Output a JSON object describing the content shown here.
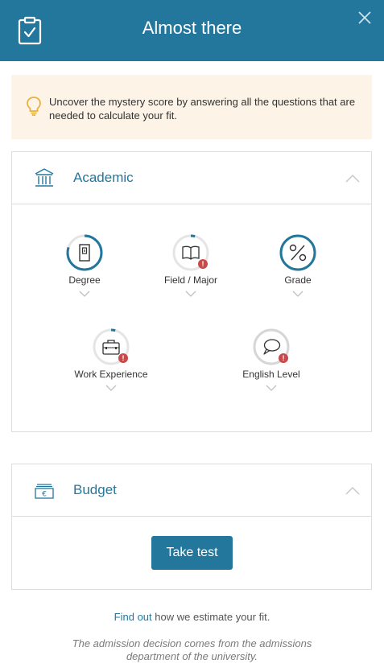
{
  "header": {
    "title": "Almost there"
  },
  "tip": {
    "text": "Uncover the mystery score by answering all the questions that are needed to calculate your fit."
  },
  "academic": {
    "title": "Academic",
    "questions": [
      {
        "label": "Degree",
        "icon": "door-icon",
        "progress": 0.8,
        "warning": false
      },
      {
        "label": "Field / Major",
        "icon": "book-icon",
        "progress": 0.04,
        "warning": true
      },
      {
        "label": "Grade",
        "icon": "percent-icon",
        "progress": 1.0,
        "warning": false
      },
      {
        "label": "Work Experience",
        "icon": "briefcase-icon",
        "progress": 0.04,
        "warning": true
      },
      {
        "label": "English Level",
        "icon": "speech-bubble-icon",
        "progress": 0.0,
        "warning": true
      }
    ]
  },
  "budget": {
    "title": "Budget",
    "button_label": "Take test"
  },
  "footer": {
    "link_text": "Find out",
    "rest_text": " how we estimate your fit.",
    "disclaimer": "The admission decision comes from the admissions department of the university."
  },
  "colors": {
    "primary": "#24779c",
    "tip_bg": "#fdf3e6",
    "warning": "#c94a4a",
    "bulb": "#e8b23a"
  }
}
